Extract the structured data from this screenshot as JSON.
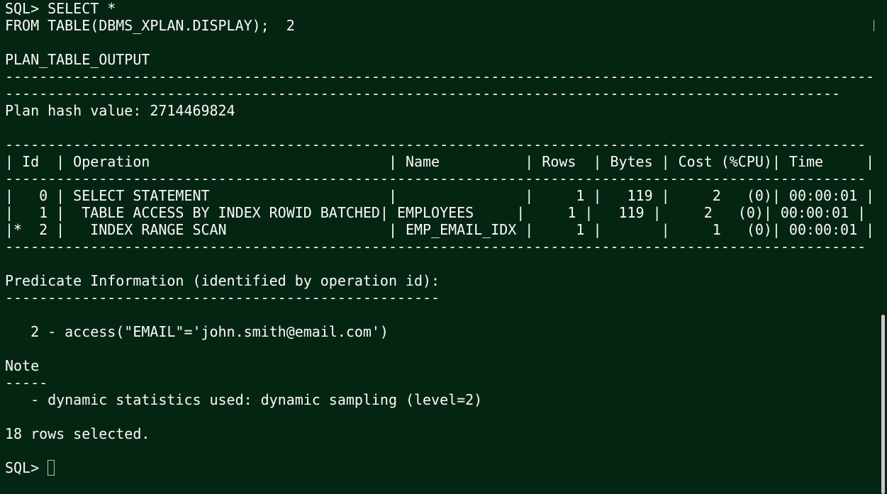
{
  "terminal": {
    "lines": [
      "SQL> SELECT *",
      "FROM TABLE(DBMS_XPLAN.DISPLAY);  2",
      "",
      "PLAN_TABLE_OUTPUT",
      "------------------------------------------------------------------------------------------------------",
      "--------------------------------------------------------------------------------------------------",
      "Plan hash value: 2714469824",
      "",
      "-----------------------------------------------------------------------------------------------------",
      "| Id  | Operation                            | Name          | Rows  | Bytes | Cost (%CPU)| Time     |",
      "-----------------------------------------------------------------------------------------------------",
      "|   0 | SELECT STATEMENT                     |               |     1 |   119 |     2   (0)| 00:00:01 |",
      "|   1 |  TABLE ACCESS BY INDEX ROWID BATCHED| EMPLOYEES     |     1 |   119 |     2   (0)| 00:00:01 |",
      "|*  2 |   INDEX RANGE SCAN                   | EMP_EMAIL_IDX |     1 |       |     1   (0)| 00:00:01 |",
      "-----------------------------------------------------------------------------------------------------",
      "",
      "Predicate Information (identified by operation id):",
      "---------------------------------------------------",
      "",
      "   2 - access(\"EMAIL\"='john.smith@email.com')",
      "",
      "Note",
      "-----",
      "   - dynamic statistics used: dynamic sampling (level=2)",
      "",
      "18 rows selected.",
      ""
    ],
    "prompt": "SQL> "
  },
  "colors": {
    "background": "#032511",
    "text": "#ffffff",
    "cursor_border": "#bfbfbf",
    "scroll_thumb": "#c9c9c9"
  }
}
